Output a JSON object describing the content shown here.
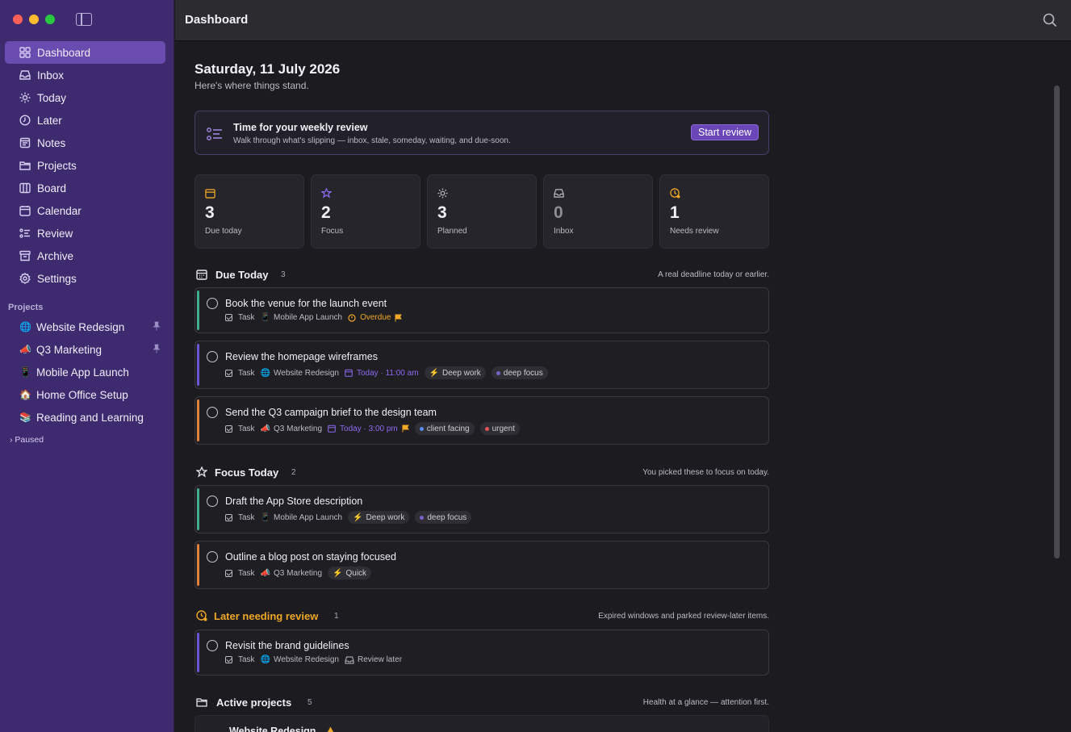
{
  "window": {
    "title": "Dashboard"
  },
  "sidebar": {
    "nav": [
      {
        "label": "Dashboard",
        "icon": "grid-icon"
      },
      {
        "label": "Inbox",
        "icon": "inbox-icon"
      },
      {
        "label": "Today",
        "icon": "sun-icon"
      },
      {
        "label": "Later",
        "icon": "clock-icon"
      },
      {
        "label": "Notes",
        "icon": "notes-icon"
      },
      {
        "label": "Projects",
        "icon": "folder-icon"
      },
      {
        "label": "Board",
        "icon": "board-icon"
      },
      {
        "label": "Calendar",
        "icon": "calendar-icon"
      },
      {
        "label": "Review",
        "icon": "review-icon"
      },
      {
        "label": "Archive",
        "icon": "archive-icon"
      },
      {
        "label": "Settings",
        "icon": "gear-icon"
      }
    ],
    "projects_header": "Projects",
    "projects": [
      {
        "label": "Website Redesign",
        "emoji": "🌐",
        "pinned": true
      },
      {
        "label": "Q3 Marketing",
        "emoji": "📣",
        "pinned": true
      },
      {
        "label": "Mobile App Launch",
        "emoji": "📱",
        "pinned": false
      },
      {
        "label": "Home Office Setup",
        "emoji": "🏠",
        "pinned": false
      },
      {
        "label": "Reading and Learning",
        "emoji": "📚",
        "pinned": false
      }
    ],
    "paused": "Paused"
  },
  "main": {
    "date": "Saturday, 11 July 2026",
    "subtitle": "Here's where things stand.",
    "review": {
      "title": "Time for your weekly review",
      "subtitle": "Walk through what's slipping — inbox, stale, someday, waiting, and due-soon.",
      "button": "Start review"
    },
    "stats": [
      {
        "value": "3",
        "label": "Due today",
        "color": "#f0a727"
      },
      {
        "value": "2",
        "label": "Focus",
        "color": "#8e6af2"
      },
      {
        "value": "3",
        "label": "Planned",
        "color": "#bdbac5"
      },
      {
        "value": "0",
        "label": "Inbox",
        "color": "#bdbac5"
      },
      {
        "value": "1",
        "label": "Needs review",
        "color": "#f0a727"
      }
    ],
    "due_today": {
      "title": "Due Today",
      "count": "3",
      "desc": "A real deadline today or earlier.",
      "tasks": [
        {
          "title": "Book the venue for the launch event",
          "type": "Task",
          "project": "Mobile App Launch",
          "project_emoji": "📱",
          "status": "Overdue",
          "accent": "#3fae8c"
        },
        {
          "title": "Review the homepage wireframes",
          "type": "Task",
          "project": "Website Redesign",
          "project_emoji": "🌐",
          "when": "Today · 11:00 am",
          "chip1": "Deep work",
          "chip2": "deep focus",
          "accent": "#6a55d8"
        },
        {
          "title": "Send the Q3 campaign brief to the design team",
          "type": "Task",
          "project": "Q3 Marketing",
          "project_emoji": "📣",
          "when": "Today · 3:00 pm",
          "chip1": "client facing",
          "chip2": "urgent",
          "accent": "#e0803a"
        }
      ]
    },
    "focus_today": {
      "title": "Focus Today",
      "count": "2",
      "desc": "You picked these to focus on today.",
      "tasks": [
        {
          "title": "Draft the App Store description",
          "type": "Task",
          "project": "Mobile App Launch",
          "project_emoji": "📱",
          "chip1": "Deep work",
          "chip2": "deep focus",
          "accent": "#3fae8c"
        },
        {
          "title": "Outline a blog post on staying focused",
          "type": "Task",
          "project": "Q3 Marketing",
          "project_emoji": "📣",
          "chip1": "Quick",
          "accent": "#e0803a"
        }
      ]
    },
    "later_review": {
      "title": "Later needing review",
      "count": "1",
      "desc": "Expired windows and parked review-later items.",
      "tasks": [
        {
          "title": "Revisit the brand guidelines",
          "type": "Task",
          "project": "Website Redesign",
          "project_emoji": "🌐",
          "status": "Review later",
          "accent": "#6a55d8"
        }
      ]
    },
    "active_projects": {
      "title": "Active projects",
      "count": "5",
      "desc": "Health at a glance — attention first.",
      "first_project": "Website Redesign"
    }
  }
}
